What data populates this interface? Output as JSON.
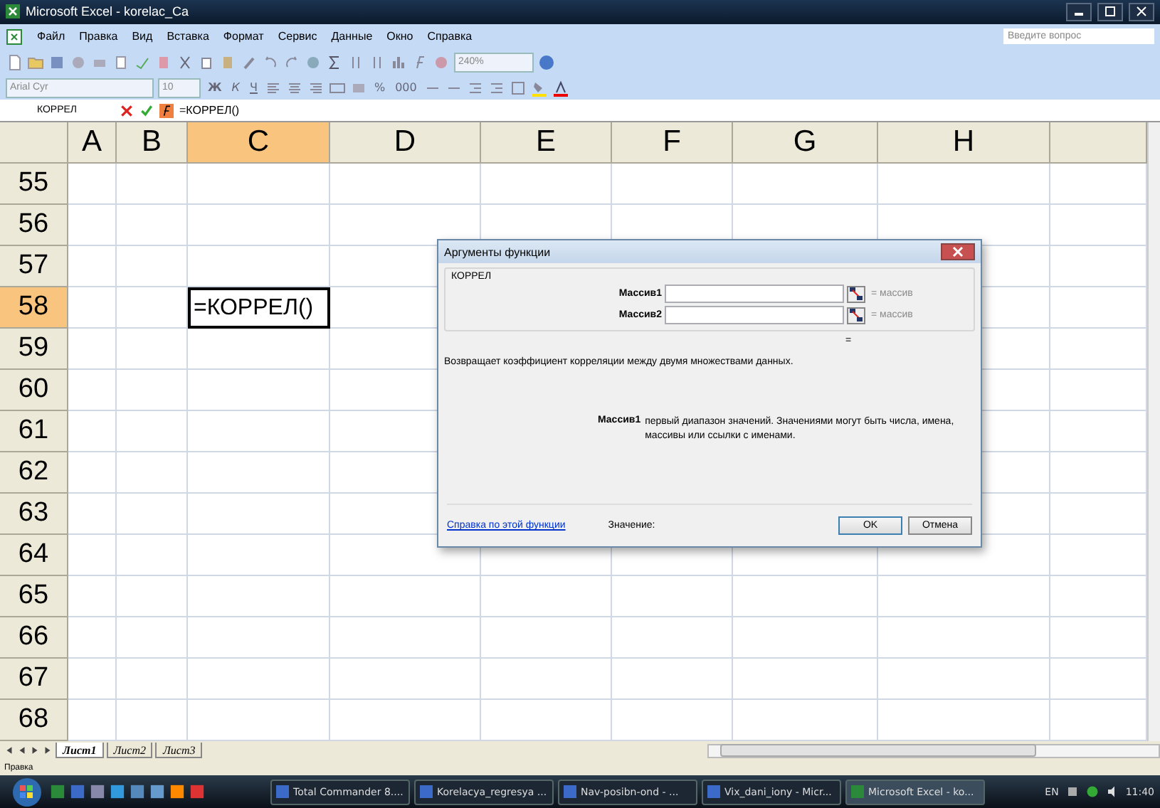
{
  "window": {
    "title": "Microsoft Excel - korelac_Ca"
  },
  "menu": [
    "Файл",
    "Правка",
    "Вид",
    "Вставка",
    "Формат",
    "Сервис",
    "Данные",
    "Окно",
    "Справка"
  ],
  "help_search": {
    "placeholder": "Введите вопрос"
  },
  "standard_toolbar": {
    "zoom": "240%"
  },
  "format_toolbar": {
    "font": "Arial Cyr",
    "size": "10",
    "bold": "Ж",
    "italic": "К",
    "underline": "Ч",
    "percent": "%",
    "thousands": "000"
  },
  "formula_bar": {
    "name_box": "КОРРЕЛ",
    "formula": "=КОРРЕЛ()"
  },
  "sheet": {
    "columns": [
      {
        "label": "A",
        "selected": false
      },
      {
        "label": "B",
        "selected": false
      },
      {
        "label": "C",
        "selected": true
      },
      {
        "label": "D",
        "selected": false
      },
      {
        "label": "E",
        "selected": false
      },
      {
        "label": "F",
        "selected": false
      },
      {
        "label": "G",
        "selected": false
      },
      {
        "label": "H",
        "selected": false
      }
    ],
    "rows": [
      {
        "label": "55",
        "selected": false
      },
      {
        "label": "56",
        "selected": false
      },
      {
        "label": "57",
        "selected": false
      },
      {
        "label": "58",
        "selected": true
      },
      {
        "label": "59",
        "selected": false
      },
      {
        "label": "60",
        "selected": false
      },
      {
        "label": "61",
        "selected": false
      },
      {
        "label": "62",
        "selected": false
      },
      {
        "label": "63",
        "selected": false
      },
      {
        "label": "64",
        "selected": false
      },
      {
        "label": "65",
        "selected": false
      },
      {
        "label": "66",
        "selected": false
      },
      {
        "label": "67",
        "selected": false
      },
      {
        "label": "68",
        "selected": false
      }
    ],
    "active_cell": {
      "value": "=КОРРЕЛ()"
    }
  },
  "dialog": {
    "title": "Аргументы функции",
    "function_name": "КОРРЕЛ",
    "arguments": [
      {
        "label": "Массив1",
        "result": "= массив"
      },
      {
        "label": "Массив2",
        "result": "= массив"
      }
    ],
    "result_sign": "=",
    "description": "Возвращает коэффициент корреляции между двумя множествами данных.",
    "argument_help": {
      "name": "Массив1",
      "text": "первый диапазон значений. Значениями могут быть числа, имена, массивы или ссылки с именами."
    },
    "help_link": "Справка по этой функции",
    "value_label": "Значение:",
    "buttons": [
      {
        "label": "OK",
        "default": true
      },
      {
        "label": "Отмена",
        "default": false
      }
    ]
  },
  "sheet_tabs": [
    {
      "label": "Лист1",
      "selected": true
    },
    {
      "label": "Лист2",
      "selected": false
    },
    {
      "label": "Лист3",
      "selected": false
    }
  ],
  "status_bar": {
    "text": "Правка"
  },
  "taskbar": {
    "tasks": [
      {
        "label": "Total Commander 8....",
        "selected": false
      },
      {
        "label": "Korelacya_regresya ...",
        "selected": false
      },
      {
        "label": "Nav-posibn-ond - ...",
        "selected": false
      },
      {
        "label": "Vix_dani_iony - Micr...",
        "selected": false
      },
      {
        "label": "Microsoft Excel - ko...",
        "selected": true
      }
    ],
    "language": "EN",
    "time": "11:40"
  }
}
